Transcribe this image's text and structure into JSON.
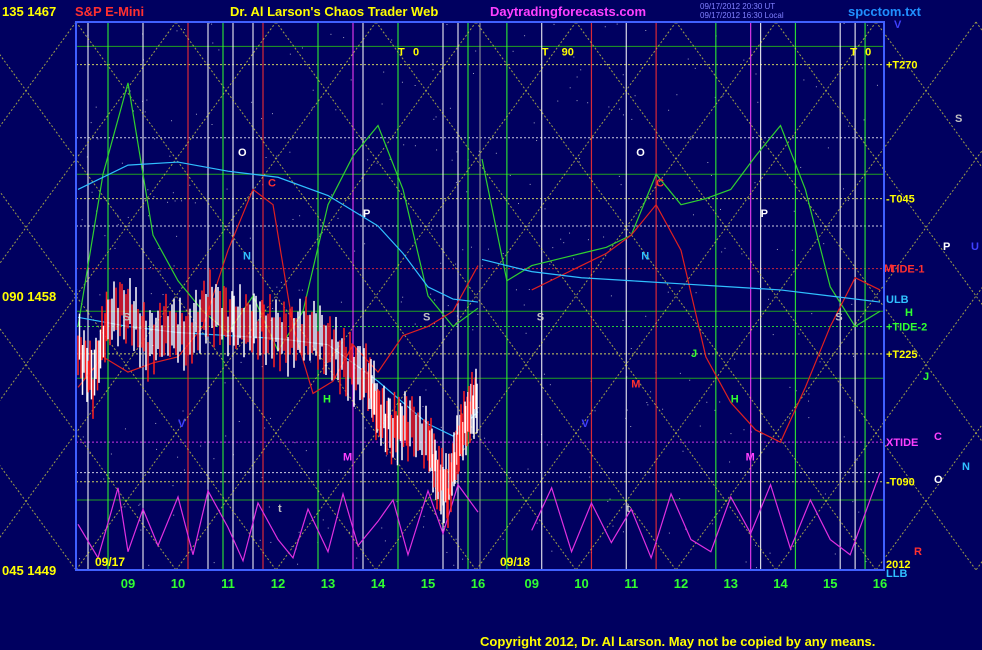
{
  "header": {
    "price_top": "135 1467",
    "instrument": "S&P E-Mini",
    "site_title": "Dr. Al Larson's Chaos Trader Web",
    "site_link": "Daytradingforecasts.com",
    "timestamp1": "09/17/2012 20:30 UT",
    "timestamp2": "09/17/2012 16:30 Local",
    "filename": "spcctom.txt"
  },
  "footer": {
    "copyright": "Copyright 2012, Dr. Al Larson. May not be copied by any means."
  },
  "chart_data": {
    "type": "line",
    "title": "S&P E-Mini",
    "ylim": [
      1449,
      1467
    ],
    "y_ticks": [
      {
        "label": "135 1467",
        "value": 1467
      },
      {
        "label": "090 1458",
        "value": 1458
      },
      {
        "label": "045 1449",
        "value": 1449
      }
    ],
    "day_labels": [
      "09/17",
      "09/18"
    ],
    "x_ticks": [
      {
        "label": "09",
        "hour": 9
      },
      {
        "label": "10",
        "hour": 10
      },
      {
        "label": "11",
        "hour": 11
      },
      {
        "label": "12",
        "hour": 12
      },
      {
        "label": "13",
        "hour": 13
      },
      {
        "label": "14",
        "hour": 14
      },
      {
        "label": "15",
        "hour": 15
      },
      {
        "label": "16",
        "hour": 16
      },
      {
        "label": "09",
        "hour": 33
      },
      {
        "label": "10",
        "hour": 34
      },
      {
        "label": "11",
        "hour": 35
      },
      {
        "label": "12",
        "hour": 36
      },
      {
        "label": "13",
        "hour": 37
      },
      {
        "label": "14",
        "hour": 38
      },
      {
        "label": "15",
        "hour": 39
      },
      {
        "label": "16",
        "hour": 40
      }
    ],
    "right_labels": [
      {
        "text": "+T270",
        "value": 1465.6,
        "color": "#ffff00"
      },
      {
        "text": "-T045",
        "value": 1461.2,
        "color": "#ffff00"
      },
      {
        "text": "-TIDE-1",
        "value": 1458.9,
        "color": "#ff3030"
      },
      {
        "text": "ULB",
        "value": 1457.9,
        "color": "#30c0ff"
      },
      {
        "text": "+TIDE-2",
        "value": 1457.0,
        "color": "#30ff30"
      },
      {
        "text": "+T225",
        "value": 1456.1,
        "color": "#ffff00"
      },
      {
        "text": "XTIDE",
        "value": 1453.2,
        "color": "#ff40ff"
      },
      {
        "text": "-T090",
        "value": 1451.9,
        "color": "#ffff00"
      },
      {
        "text": "2012",
        "value": 1449.2,
        "color": "#ffff00"
      },
      {
        "text": "LLB",
        "value": 1448.9,
        "color": "#30c0ff"
      }
    ],
    "legend_letters": [
      {
        "text": "S",
        "color": "#c0c0c0"
      },
      {
        "text": "P",
        "color": "#ffffff"
      },
      {
        "text": "U",
        "color": "#4040ff"
      },
      {
        "text": "M",
        "color": "#ff3030"
      },
      {
        "text": "H",
        "color": "#30ff30"
      },
      {
        "text": "J",
        "color": "#30ff30"
      },
      {
        "text": "C",
        "color": "#ff40ff"
      },
      {
        "text": "N",
        "color": "#30c0ff"
      },
      {
        "text": "O",
        "color": "#ffffff"
      },
      {
        "text": "R",
        "color": "#ff3030"
      },
      {
        "text": "V",
        "color": "#4040ff"
      }
    ],
    "plot_letters": [
      {
        "text": "T",
        "hour": 14.4,
        "value": 1465.9,
        "color": "#ffff00"
      },
      {
        "text": "0",
        "hour": 14.7,
        "value": 1465.9,
        "color": "#ffff00"
      },
      {
        "text": "T",
        "hour": 33.2,
        "value": 1465.9,
        "color": "#ffff00"
      },
      {
        "text": "90",
        "hour": 33.6,
        "value": 1465.9,
        "color": "#ffff00"
      },
      {
        "text": "T",
        "hour": 39.4,
        "value": 1465.9,
        "color": "#ffff00"
      },
      {
        "text": "0",
        "hour": 39.7,
        "value": 1465.9,
        "color": "#ffff00"
      },
      {
        "text": "O",
        "hour": 11.2,
        "value": 1462.6,
        "color": "#ffffff"
      },
      {
        "text": "C",
        "hour": 11.8,
        "value": 1461.6,
        "color": "#ff3030"
      },
      {
        "text": "N",
        "hour": 11.3,
        "value": 1459.2,
        "color": "#30c0ff"
      },
      {
        "text": "P",
        "hour": 13.7,
        "value": 1460.6,
        "color": "#ffffff"
      },
      {
        "text": "S",
        "hour": 14.9,
        "value": 1457.2,
        "color": "#c0c0c0"
      },
      {
        "text": "S",
        "hour": 8.9,
        "value": 1457.2,
        "color": "#c0c0c0"
      },
      {
        "text": "H",
        "hour": 12.9,
        "value": 1454.5,
        "color": "#30ff30"
      },
      {
        "text": "V",
        "hour": 10.0,
        "value": 1453.7,
        "color": "#4040ff"
      },
      {
        "text": "M",
        "hour": 13.3,
        "value": 1452.6,
        "color": "#ff40ff"
      },
      {
        "text": "O",
        "hour": 35.1,
        "value": 1462.6,
        "color": "#ffffff"
      },
      {
        "text": "C",
        "hour": 35.5,
        "value": 1461.6,
        "color": "#ff3030"
      },
      {
        "text": "N",
        "hour": 35.2,
        "value": 1459.2,
        "color": "#30c0ff"
      },
      {
        "text": "P",
        "hour": 37.6,
        "value": 1460.6,
        "color": "#ffffff"
      },
      {
        "text": "S",
        "hour": 33.1,
        "value": 1457.2,
        "color": "#c0c0c0"
      },
      {
        "text": "S",
        "hour": 39.1,
        "value": 1457.2,
        "color": "#c0c0c0"
      },
      {
        "text": "J",
        "hour": 36.2,
        "value": 1456.0,
        "color": "#30ff30"
      },
      {
        "text": "H",
        "hour": 37.0,
        "value": 1454.5,
        "color": "#30ff30"
      },
      {
        "text": "V",
        "hour": 34.0,
        "value": 1453.7,
        "color": "#4040ff"
      },
      {
        "text": "M",
        "hour": 37.3,
        "value": 1452.6,
        "color": "#ff40ff"
      },
      {
        "text": "M",
        "hour": 35.0,
        "value": 1455.0,
        "color": "#ff3030"
      },
      {
        "text": "t",
        "hour": 12.0,
        "value": 1450.9,
        "color": "#c0c0c0"
      },
      {
        "text": "t",
        "hour": 34.9,
        "value": 1450.9,
        "color": "#c0c0c0"
      }
    ],
    "series": [
      {
        "name": "price",
        "color": "#ff2020",
        "x": [
          8.0,
          8.3,
          8.6,
          9.0,
          9.4,
          9.8,
          10.2,
          10.6,
          11.0,
          11.4,
          11.8,
          12.2,
          12.6,
          13.0,
          13.4,
          13.8,
          14.0,
          14.3,
          14.6,
          15.0,
          15.2,
          15.4,
          15.6,
          15.8,
          16.0
        ],
        "y": [
          1456.3,
          1455.2,
          1457.3,
          1457.6,
          1456.4,
          1457.0,
          1456.6,
          1457.7,
          1457.2,
          1457.1,
          1456.9,
          1456.6,
          1456.9,
          1456.4,
          1455.7,
          1455.3,
          1454.2,
          1453.6,
          1453.8,
          1453.3,
          1452.0,
          1451.6,
          1453.1,
          1454.1,
          1454.7
        ]
      },
      {
        "name": "green",
        "color": "#30d030",
        "x": [
          8.0,
          8.5,
          9.0,
          9.5,
          10.0,
          10.5,
          11.0,
          11.5,
          12.0,
          12.5,
          13.0,
          13.5,
          14.0,
          14.5,
          15.0,
          15.5,
          16.0,
          32.0,
          32.5,
          33.0,
          33.5,
          34.0,
          34.5,
          35.0,
          35.5,
          36.0,
          36.5,
          37.0,
          37.5,
          38.0,
          38.5,
          39.0,
          39.5,
          40.0
        ],
        "y": [
          1457.0,
          1462.0,
          1465.0,
          1460.0,
          1458.5,
          1457.5,
          1456.8,
          1458.0,
          1456.2,
          1457.5,
          1461.0,
          1462.6,
          1463.6,
          1461.5,
          1458.0,
          1457.0,
          1457.6,
          1462.5,
          1458.5,
          1459.0,
          1459.2,
          1459.4,
          1459.6,
          1460.0,
          1462.0,
          1461.0,
          1461.2,
          1461.5,
          1462.6,
          1463.6,
          1461.5,
          1458.3,
          1457.0,
          1457.5
        ]
      },
      {
        "name": "red-wave",
        "color": "#e02020",
        "x": [
          8.0,
          8.5,
          9.0,
          9.5,
          10.0,
          10.5,
          11.0,
          11.5,
          11.9,
          12.3,
          12.7,
          13.1,
          13.5,
          14.0,
          14.5,
          15.0,
          15.5,
          16.0,
          33.0,
          33.5,
          34.0,
          34.5,
          35.0,
          35.5,
          36.0,
          36.5,
          37.0,
          37.5,
          38.0,
          38.5,
          39.0,
          39.5,
          40.0
        ],
        "y": [
          1455.0,
          1456.0,
          1455.5,
          1455.8,
          1456.0,
          1457.0,
          1459.5,
          1461.5,
          1461.0,
          1457.0,
          1454.8,
          1455.2,
          1456.4,
          1455.5,
          1456.7,
          1457.0,
          1457.5,
          1459.0,
          1458.2,
          1458.6,
          1459.0,
          1459.4,
          1460.0,
          1461.0,
          1459.5,
          1456.0,
          1454.5,
          1453.6,
          1453.2,
          1455.0,
          1457.0,
          1458.6,
          1458.2
        ]
      },
      {
        "name": "cyan-upper",
        "color": "#30c0ff",
        "x": [
          8.0,
          9.0,
          10.0,
          11.0,
          12.0,
          13.0,
          14.0,
          14.5,
          15.0,
          15.5,
          16.0,
          32.0,
          33.0,
          34.0,
          35.0,
          36.0,
          37.0,
          38.0,
          39.0,
          40.0
        ],
        "y": [
          1461.5,
          1462.3,
          1462.4,
          1462.1,
          1461.9,
          1461.3,
          1460.3,
          1459.4,
          1458.3,
          1457.9,
          1457.8,
          1459.2,
          1458.8,
          1458.6,
          1458.5,
          1458.4,
          1458.3,
          1458.2,
          1458.0,
          1457.8
        ]
      },
      {
        "name": "cyan-lower",
        "color": "#30c0ff",
        "x": [
          8.0,
          9.0,
          10.0,
          11.0,
          12.0,
          13.0,
          13.5,
          14.0,
          14.5,
          15.0,
          15.5,
          16.0
        ],
        "y": [
          1457.3,
          1457.0,
          1456.8,
          1456.7,
          1456.6,
          1456.4,
          1455.8,
          1455.2,
          1454.5,
          1453.8,
          1453.4,
          1454.2
        ]
      },
      {
        "name": "magenta",
        "color": "#e030e0",
        "x": [
          8.0,
          8.4,
          8.8,
          9.0,
          9.3,
          9.6,
          10.0,
          10.3,
          10.6,
          11.0,
          11.3,
          11.6,
          12.0,
          12.3,
          12.6,
          13.0,
          13.3,
          13.6,
          14.0,
          14.3,
          14.6,
          15.0,
          15.3,
          15.6,
          16.0,
          33.0,
          33.4,
          33.8,
          34.2,
          34.6,
          35.0,
          35.4,
          35.8,
          36.2,
          36.6,
          37.0,
          37.4,
          37.8,
          38.2,
          38.6,
          39.0,
          39.4,
          39.8,
          40.0
        ],
        "y": [
          1450.5,
          1449.4,
          1451.7,
          1449.6,
          1451.0,
          1449.8,
          1451.4,
          1449.5,
          1451.6,
          1450.4,
          1449.3,
          1451.2,
          1450.0,
          1449.4,
          1451.0,
          1449.6,
          1451.5,
          1449.8,
          1450.6,
          1451.3,
          1449.5,
          1451.6,
          1450.2,
          1451.8,
          1450.9,
          1450.3,
          1451.7,
          1449.6,
          1451.2,
          1449.9,
          1451.0,
          1449.4,
          1451.5,
          1450.0,
          1449.6,
          1451.4,
          1450.2,
          1451.8,
          1449.7,
          1451.3,
          1450.0,
          1449.5,
          1451.3,
          1452.2
        ]
      }
    ],
    "hlines": [
      {
        "value": 1465.6,
        "color": "#ffff60"
      },
      {
        "value": 1461.2,
        "color": "#ffff60"
      },
      {
        "value": 1458.9,
        "color": "#ff3030"
      },
      {
        "value": 1457.0,
        "color": "#30ff30"
      },
      {
        "value": 1456.1,
        "color": "#ffff60"
      },
      {
        "value": 1453.2,
        "color": "#ff40ff"
      },
      {
        "value": 1451.9,
        "color": "#ffff60"
      },
      {
        "value": 1463.2,
        "color": "#ffffff"
      },
      {
        "value": 1460.3,
        "color": "#ffffff"
      },
      {
        "value": 1452.2,
        "color": "#ffffff"
      }
    ],
    "vlines": [
      {
        "hour": 8.2,
        "color": "#ffffff"
      },
      {
        "hour": 8.6,
        "color": "#30ff30"
      },
      {
        "hour": 9.3,
        "color": "#ffffff"
      },
      {
        "hour": 10.2,
        "color": "#ff3030"
      },
      {
        "hour": 10.6,
        "color": "#ffffff"
      },
      {
        "hour": 10.9,
        "color": "#30ff30"
      },
      {
        "hour": 11.1,
        "color": "#ffffff"
      },
      {
        "hour": 11.5,
        "color": "#ffffff"
      },
      {
        "hour": 11.7,
        "color": "#ff3030"
      },
      {
        "hour": 12.8,
        "color": "#30ff30"
      },
      {
        "hour": 13.5,
        "color": "#ff40ff"
      },
      {
        "hour": 13.7,
        "color": "#ffffff"
      },
      {
        "hour": 14.4,
        "color": "#30ff30"
      },
      {
        "hour": 15.3,
        "color": "#ffffff"
      },
      {
        "hour": 15.6,
        "color": "#ffffff"
      },
      {
        "hour": 15.8,
        "color": "#30ff30"
      },
      {
        "hour": 32.5,
        "color": "#30ff30"
      },
      {
        "hour": 33.2,
        "color": "#ffffff"
      },
      {
        "hour": 34.2,
        "color": "#ff3030"
      },
      {
        "hour": 34.9,
        "color": "#ffffff"
      },
      {
        "hour": 35.5,
        "color": "#ff3030"
      },
      {
        "hour": 36.7,
        "color": "#30ff30"
      },
      {
        "hour": 37.4,
        "color": "#ff40ff"
      },
      {
        "hour": 37.6,
        "color": "#ffffff"
      },
      {
        "hour": 38.3,
        "color": "#30ff30"
      },
      {
        "hour": 39.2,
        "color": "#ffffff"
      },
      {
        "hour": 39.5,
        "color": "#ffffff"
      },
      {
        "hour": 39.7,
        "color": "#30ff30"
      }
    ],
    "grid": true
  }
}
